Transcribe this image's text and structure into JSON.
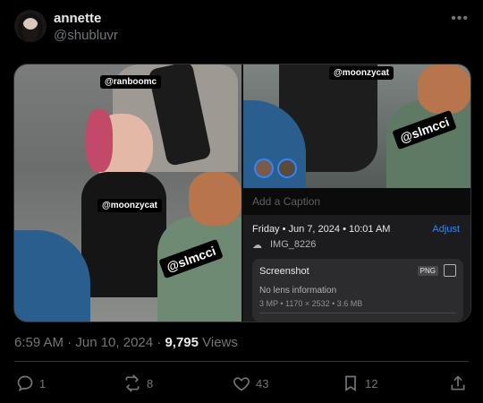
{
  "user": {
    "name": "annette",
    "handle": "@shubluvr"
  },
  "media": {
    "left_tags": [
      "@ranboomc",
      "@moonzycat",
      "@slmcci"
    ],
    "right_tags": [
      "@moonzycat",
      "@slmcci"
    ],
    "caption_placeholder": "Add a Caption",
    "photo_date": "Friday • Jun 7, 2024 • 10:01 AM",
    "adjust_label": "Adjust",
    "image_name": "IMG_8226",
    "card_title": "Screenshot",
    "format_badge": "PNG",
    "lens_info": "No lens information",
    "specs": "3 MP  •  1170 × 2532  •  3.6 MB"
  },
  "post": {
    "time": "6:59 AM · Jun 10, 2024 · ",
    "views_count": "9,795",
    "views_label": " Views"
  },
  "actions": {
    "replies": "1",
    "reposts": "8",
    "likes": "43",
    "bookmarks": "12"
  },
  "colors": {
    "background": "#000000",
    "secondary_text": "#71767b",
    "link_blue": "#2f86ff"
  },
  "icons": [
    "more-icon",
    "reply-icon",
    "repost-icon",
    "like-icon",
    "bookmark-icon",
    "share-icon",
    "cloud-icon",
    "scan-icon"
  ]
}
